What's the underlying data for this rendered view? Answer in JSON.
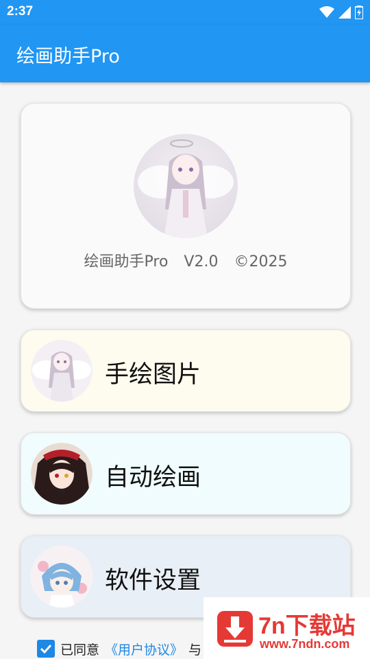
{
  "status": {
    "time": "2:37"
  },
  "app": {
    "title": "绘画助手Pro"
  },
  "info": {
    "name": "绘画助手Pro",
    "version": "V2.0",
    "copyright": "©2025"
  },
  "menu": [
    {
      "label": "手绘图片",
      "bg": "#fefbef"
    },
    {
      "label": "自动绘画",
      "bg": "#f0fcfd"
    },
    {
      "label": "软件设置",
      "bg": "#e9eff6"
    }
  ],
  "agreement": {
    "prefix": "已同意",
    "link": "《用户协议》",
    "suffix": "与"
  },
  "watermark": {
    "title": "7n下载站",
    "url": "www.7ndn.com"
  }
}
